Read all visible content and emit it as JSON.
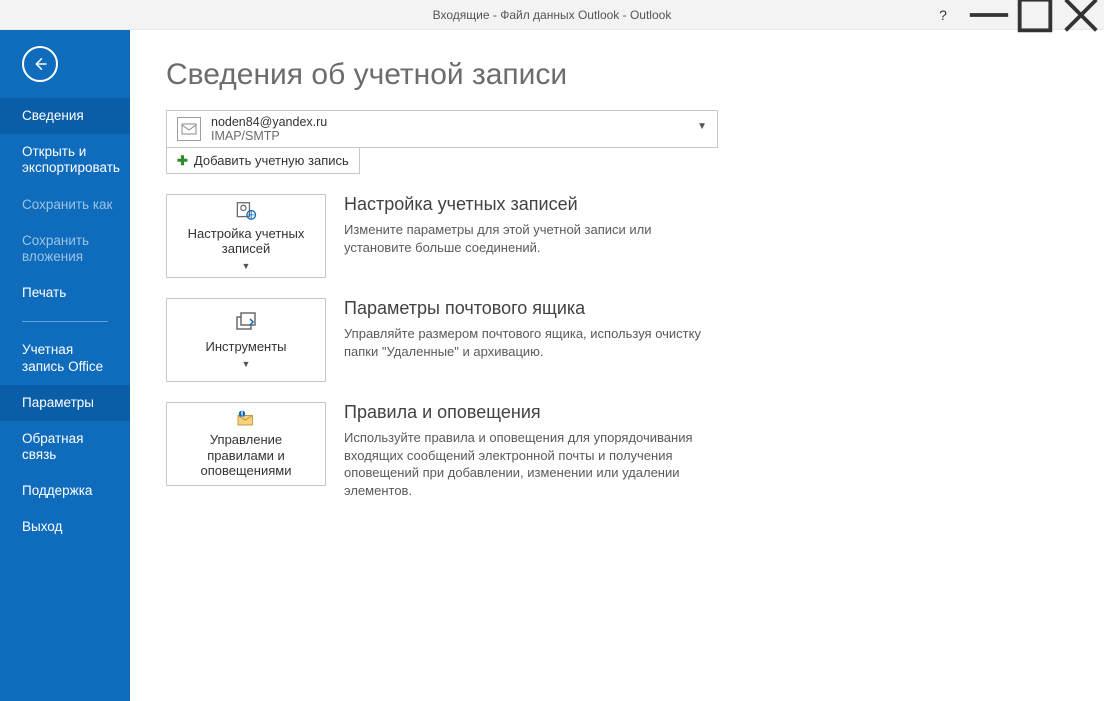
{
  "titlebar": {
    "title": "Входящие - Файл данных Outlook - Outlook"
  },
  "sidebar": {
    "items": [
      {
        "label": "Сведения",
        "state": "active"
      },
      {
        "label": "Открыть и экспортировать",
        "state": ""
      },
      {
        "label": "Сохранить как",
        "state": "disabled"
      },
      {
        "label": "Сохранить вложения",
        "state": "disabled"
      },
      {
        "label": "Печать",
        "state": ""
      },
      {
        "label": "Учетная запись Office",
        "state": ""
      },
      {
        "label": "Параметры",
        "state": "selected"
      },
      {
        "label": "Обратная связь",
        "state": ""
      },
      {
        "label": "Поддержка",
        "state": ""
      },
      {
        "label": "Выход",
        "state": ""
      }
    ]
  },
  "page": {
    "title": "Сведения об учетной записи"
  },
  "account": {
    "email": "noden84@yandex.ru",
    "protocol": "IMAP/SMTP",
    "add_label": "Добавить учетную запись"
  },
  "sections": [
    {
      "tile_label": "Настройка учетных записей",
      "has_caret": true,
      "title": "Настройка учетных записей",
      "desc": "Измените параметры для этой учетной записи или установите больше соединений.",
      "icon": "account-settings"
    },
    {
      "tile_label": "Инструменты",
      "has_caret": true,
      "title": "Параметры почтового ящика",
      "desc": "Управляйте размером почтового ящика, используя очистку папки \"Удаленные\" и архивацию.",
      "icon": "tools"
    },
    {
      "tile_label": "Управление правилами и оповещениями",
      "has_caret": false,
      "title": "Правила и оповещения",
      "desc": "Используйте правила и оповещения для упорядочивания входящих сообщений электронной почты и получения оповещений при добавлении, изменении или удалении элементов.",
      "icon": "rules"
    }
  ]
}
